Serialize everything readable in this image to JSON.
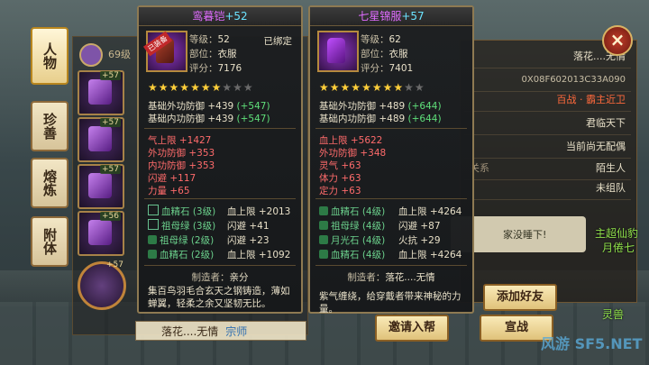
{
  "tabs": [
    "人物",
    "珍善",
    "熔炼",
    "附体"
  ],
  "level_label": "69级",
  "equip_slots": [
    "+57",
    "+57",
    "+57",
    "+56",
    "+57"
  ],
  "right_panel": {
    "rows": [
      {
        "label": "",
        "value": "落花....无情"
      },
      {
        "label": "",
        "value": "0X08F602013C33A090"
      },
      {
        "label": "",
        "value": "百战 · 霸主近卫"
      },
      {
        "label": "",
        "value": "君临天下"
      },
      {
        "label": "",
        "value": "当前尚无配偶"
      },
      {
        "label": "关系",
        "value": "陌生人"
      },
      {
        "label": "",
        "value": "未组队"
      }
    ],
    "close_icon": "×"
  },
  "buttons": {
    "add_friend": "添加好友",
    "invite": "邀请入帮",
    "declare_war": "宣战"
  },
  "bottom_name": {
    "name": "落花....无情",
    "tag": "宗师"
  },
  "chat_snippet": "家没睡下!",
  "green_overlay": [
    "主超仙豹",
    "月倦七",
    "灵兽"
  ],
  "watermark": "风游 SF5.NET",
  "card_left": {
    "name": "鸾暮铠",
    "plus": "+52",
    "ribbon": "已装备",
    "level_k": "等级：",
    "level_v": "52",
    "bound": "已绑定",
    "slot_k": "部位：",
    "slot_v": "衣服",
    "score_k": "评分：",
    "score_v": "7176",
    "stars_on": 7,
    "stars_total": 10,
    "base": [
      {
        "text": "基础外功防御 +439",
        "bonus": "(+547)"
      },
      {
        "text": "基础内功防御 +439",
        "bonus": "(+547)"
      }
    ],
    "attrs": [
      "气上限 +1427",
      "外功防御 +353",
      "内功防御 +353",
      "闪避 +117",
      "力量 +65"
    ],
    "gems": [
      {
        "name": "血精石 (3级)",
        "value": "血上限 +2013",
        "check": false
      },
      {
        "name": "祖母绿 (3级)",
        "value": "闪避 +41",
        "check": false
      },
      {
        "name": "祖母绿 (2级)",
        "value": "闪避 +23",
        "check": true
      },
      {
        "name": "血精石 (2级)",
        "value": "血上限 +1092",
        "check": true
      }
    ],
    "maker_k": "制造者：",
    "maker_v": "亲分",
    "desc": "集百鸟羽毛合玄天之钢铸造，薄如蝉翼，轻柔之余又坚韧无比。"
  },
  "card_right": {
    "name": "七星锦服",
    "plus": "+57",
    "level_k": "等级：",
    "level_v": "62",
    "slot_k": "部位：",
    "slot_v": "衣服",
    "score_k": "评分：",
    "score_v": "7401",
    "stars_on": 8,
    "stars_total": 10,
    "base": [
      {
        "text": "基础外功防御 +489",
        "bonus": "(+644)"
      },
      {
        "text": "基础内功防御 +489",
        "bonus": "(+644)"
      }
    ],
    "attrs": [
      "血上限 +5622",
      "外功防御 +348",
      "灵气 +63",
      "体力 +63",
      "定力 +63"
    ],
    "gems": [
      {
        "name": "血精石 (4级)",
        "value": "血上限 +4264",
        "check": true
      },
      {
        "name": "祖母绿 (4级)",
        "value": "闪避 +87",
        "check": true
      },
      {
        "name": "月光石 (4级)",
        "value": "火抗 +29",
        "check": true
      },
      {
        "name": "血精石 (4级)",
        "value": "血上限 +4264",
        "check": true
      }
    ],
    "maker_k": "制造者：",
    "maker_v": "落花....无情",
    "desc": "紫气缠绕，给穿戴者带来神秘的力量。"
  }
}
